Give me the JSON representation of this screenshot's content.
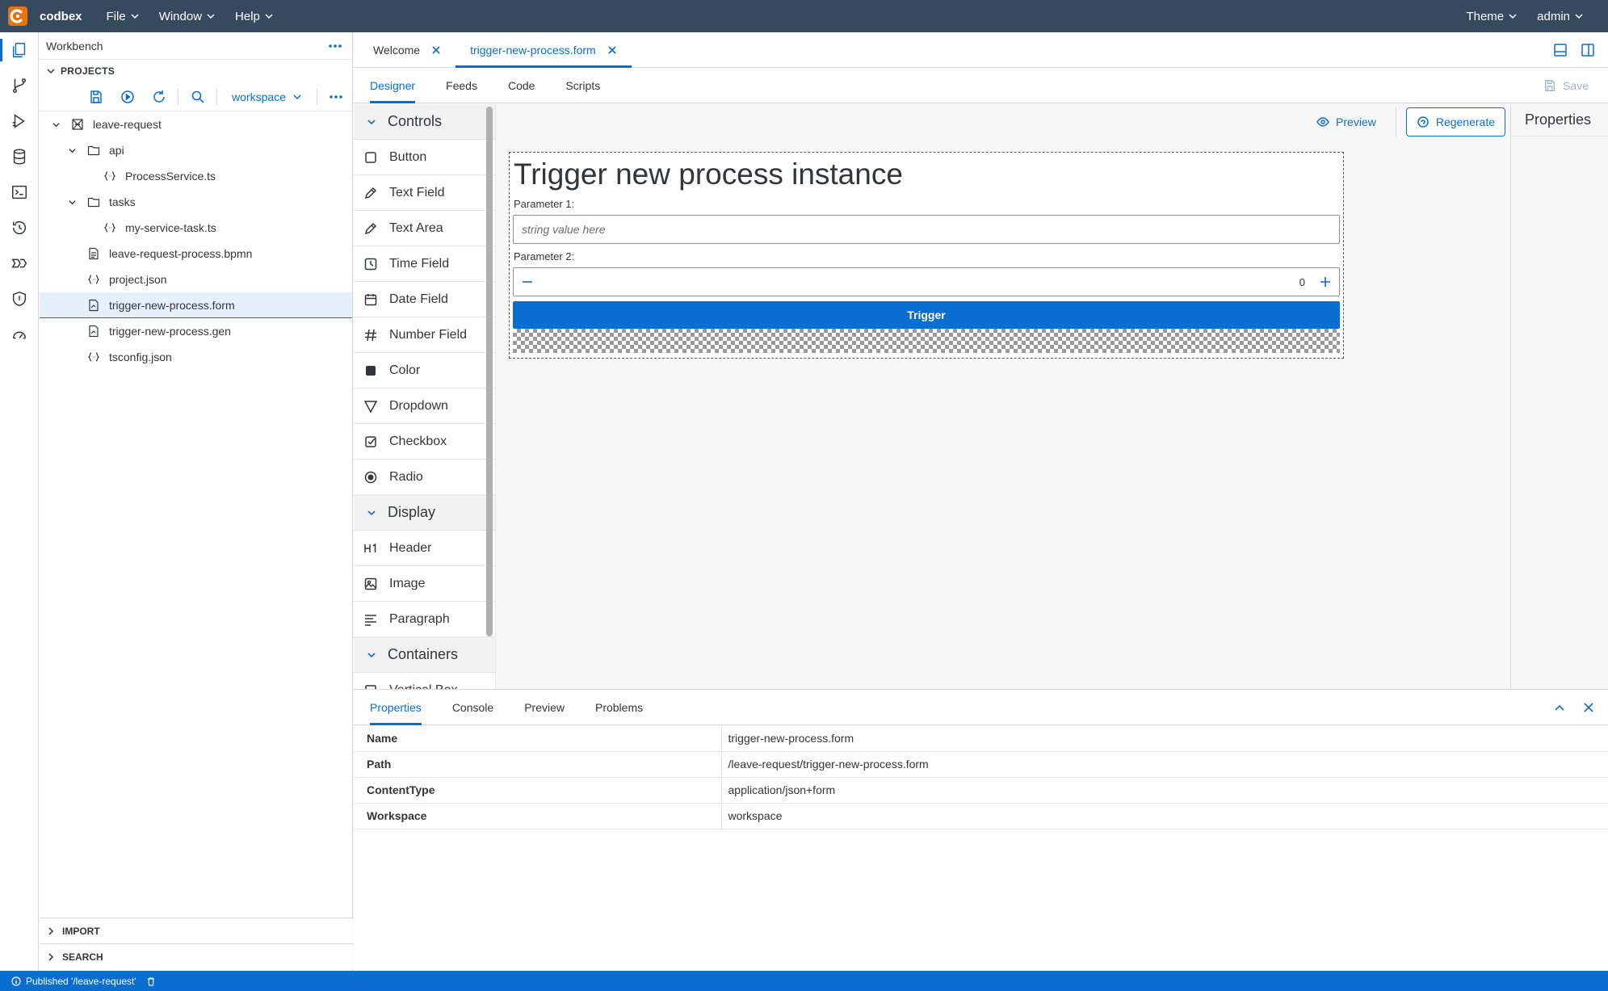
{
  "topbar": {
    "brand": "codbex",
    "menus": [
      "File",
      "Window",
      "Help"
    ],
    "theme_label": "Theme",
    "user_label": "admin"
  },
  "sidebar": {
    "title": "Workbench",
    "section_projects": "PROJECTS",
    "workspace_select": "workspace",
    "tree": [
      {
        "label": "leave-request",
        "icon": "project-icon",
        "level": 0,
        "expandable": true
      },
      {
        "label": "api",
        "icon": "folder-icon",
        "level": 1,
        "expandable": true
      },
      {
        "label": "ProcessService.ts",
        "icon": "code-file-icon",
        "level": 2,
        "expandable": false
      },
      {
        "label": "tasks",
        "icon": "folder-icon",
        "level": 1,
        "expandable": true
      },
      {
        "label": "my-service-task.ts",
        "icon": "code-file-icon",
        "level": 2,
        "expandable": false
      },
      {
        "label": "leave-request-process.bpmn",
        "icon": "document-icon",
        "level": 1,
        "expandable": false
      },
      {
        "label": "project.json",
        "icon": "code-file-icon",
        "level": 1,
        "expandable": false
      },
      {
        "label": "trigger-new-process.form",
        "icon": "form-file-icon",
        "level": 1,
        "expandable": false,
        "selected": true
      },
      {
        "label": "trigger-new-process.gen",
        "icon": "form-file-icon",
        "level": 1,
        "expandable": false
      },
      {
        "label": "tsconfig.json",
        "icon": "code-file-icon",
        "level": 1,
        "expandable": false
      }
    ],
    "section_import": "IMPORT",
    "section_search": "SEARCH"
  },
  "editor": {
    "tabs": [
      {
        "label": "Welcome",
        "active": false
      },
      {
        "label": "trigger-new-process.form",
        "active": true
      }
    ],
    "subtabs": [
      "Designer",
      "Feeds",
      "Code",
      "Scripts"
    ],
    "save_label": "Save"
  },
  "palette": {
    "groups": [
      {
        "label": "Controls",
        "items": [
          {
            "label": "Button",
            "icon": "checkbox-empty-icon"
          },
          {
            "label": "Text Field",
            "icon": "pencil-icon"
          },
          {
            "label": "Text Area",
            "icon": "pencil-icon"
          },
          {
            "label": "Time Field",
            "icon": "clock-icon"
          },
          {
            "label": "Date Field",
            "icon": "calendar-icon"
          },
          {
            "label": "Number Field",
            "icon": "hash-icon"
          },
          {
            "label": "Color",
            "icon": "color-square-icon"
          },
          {
            "label": "Dropdown",
            "icon": "triangle-down-icon"
          },
          {
            "label": "Checkbox",
            "icon": "checkbox-checked-icon"
          },
          {
            "label": "Radio",
            "icon": "radio-icon"
          }
        ]
      },
      {
        "label": "Display",
        "items": [
          {
            "label": "Header",
            "icon": "heading-icon"
          },
          {
            "label": "Image",
            "icon": "image-icon"
          },
          {
            "label": "Paragraph",
            "icon": "paragraph-icon"
          }
        ]
      },
      {
        "label": "Containers",
        "items": [
          {
            "label": "Vertical Box",
            "icon": "box-icon"
          }
        ]
      }
    ]
  },
  "canvas": {
    "preview_label": "Preview",
    "regenerate_label": "Regenerate",
    "form": {
      "header": "Trigger new process instance",
      "param1_label": "Parameter 1:",
      "param1_placeholder": "string value here",
      "param2_label": "Parameter 2:",
      "param2_value": "0",
      "trigger_label": "Trigger"
    }
  },
  "properties_panel": {
    "title": "Properties"
  },
  "bottom_panel": {
    "tabs": [
      "Properties",
      "Console",
      "Preview",
      "Problems"
    ],
    "rows": [
      {
        "key": "Name",
        "value": "trigger-new-process.form"
      },
      {
        "key": "Path",
        "value": "/leave-request/trigger-new-process.form"
      },
      {
        "key": "ContentType",
        "value": "application/json+form"
      },
      {
        "key": "Workspace",
        "value": "workspace"
      }
    ]
  },
  "statusbar": {
    "message": "Published '/leave-request'"
  },
  "colors": {
    "topbar": "#354a5f",
    "accent": "#0a6ed1",
    "brand": "#e9730c"
  }
}
